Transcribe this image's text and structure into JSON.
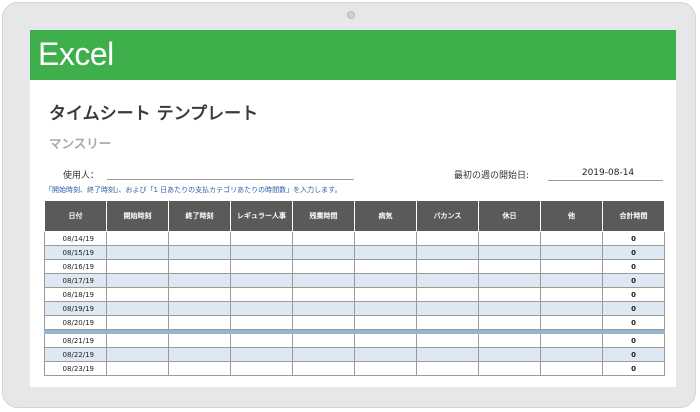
{
  "app": {
    "banner_title": "Excel"
  },
  "document": {
    "title": "タイムシート テンプレート",
    "subtitle": "マンスリー",
    "user_label": "使用人：",
    "week_start_label": "最初の週の開始日:",
    "week_start_value": "2019-08-14",
    "instruction": "「開始時刻、終了時刻」、および「1 日あたりの支払カテゴリあたりの時間数」を入力します。"
  },
  "table": {
    "headers": [
      "日付",
      "開始時刻",
      "終了時刻",
      "レギュラー人事",
      "残業時間",
      "病気",
      "バカンス",
      "休日",
      "他",
      "合計時間"
    ],
    "week1": [
      {
        "date": "08/14/19",
        "total": "0"
      },
      {
        "date": "08/15/19",
        "total": "0"
      },
      {
        "date": "08/16/19",
        "total": "0"
      },
      {
        "date": "08/17/19",
        "total": "0"
      },
      {
        "date": "08/18/19",
        "total": "0"
      },
      {
        "date": "08/19/19",
        "total": "0"
      },
      {
        "date": "08/20/19",
        "total": "0"
      }
    ],
    "week2": [
      {
        "date": "08/21/19",
        "total": "0"
      },
      {
        "date": "08/22/19",
        "total": "0"
      },
      {
        "date": "08/23/19",
        "total": "0"
      }
    ]
  },
  "colors": {
    "banner": "#3eaf4b",
    "header_bg": "#5a5a5a",
    "row_alt": "#dde8f2",
    "week_separator": "#94b4d1",
    "instruction_text": "#2b5fa6"
  }
}
